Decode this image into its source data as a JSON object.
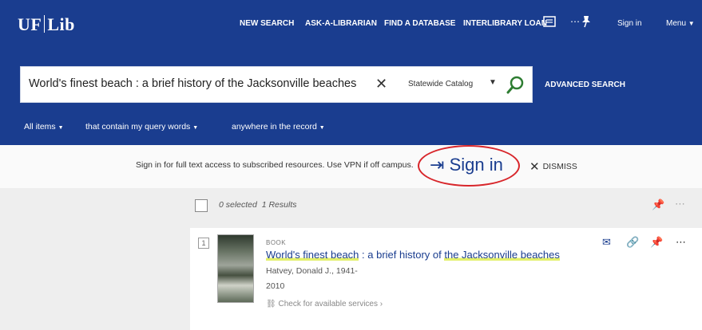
{
  "header": {
    "logo_left": "UF",
    "logo_right": "Lib",
    "nav": [
      "NEW SEARCH",
      "ASK-A-LIBRARIAN",
      "FIND A DATABASE",
      "INTERLIBRARY LOAN"
    ],
    "sign_in": "Sign in",
    "menu": "Menu"
  },
  "search": {
    "query": "World's finest beach : a brief history of the Jacksonville beaches",
    "scope": "Statewide Catalog",
    "advanced": "ADVANCED SEARCH",
    "filters": [
      "All items",
      "that contain my query words",
      "anywhere in the record"
    ]
  },
  "notice": {
    "text": "Sign in for full text access to subscribed resources. Use VPN if off campus.",
    "sign_in": "Sign in",
    "dismiss": "DISMISS"
  },
  "results": {
    "selected": "0 selected",
    "count": "1 Results",
    "items": [
      {
        "number": "1",
        "type": "BOOK",
        "title_parts": [
          "World's finest beach",
          " : a brief history of ",
          "the Jacksonville beaches"
        ],
        "author": "Hatvey, Donald J., 1941-",
        "year": "2010",
        "availability": "Check for available services"
      }
    ]
  },
  "colors": {
    "brand": "#1a3d8f",
    "highlight_oval": "#d8262b",
    "title_highlight": "#e3f06b"
  }
}
